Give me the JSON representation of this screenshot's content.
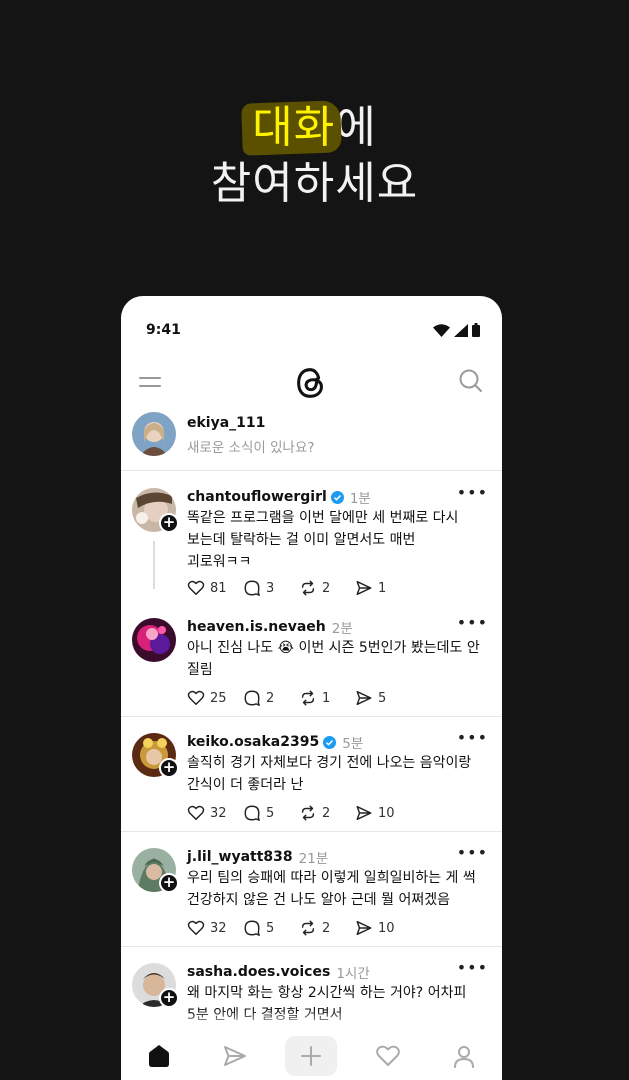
{
  "headline": {
    "highlight": "대화",
    "rest1": "에",
    "line2": "참여하세요"
  },
  "status": {
    "time": "9:41"
  },
  "compose": {
    "username": "ekiya_111",
    "placeholder": "새로운 소식이 있나요?"
  },
  "posts": [
    {
      "username": "chantouflowergirl",
      "verified": true,
      "ago": "1분",
      "lines": [
        "똑같은 프로그램을 이번 달에만 세 번째로 다시",
        "보는데 탈락하는 걸 이미 알면서도 매번",
        "괴로워ㅋㅋ"
      ],
      "likes": "81",
      "replies": "3",
      "reposts": "2",
      "shares": "1"
    },
    {
      "username": "heaven.is.nevaeh",
      "verified": false,
      "ago": "2분",
      "lines": [
        "아니 진심 나도 😭 이번 시즌 5번인가 봤는데도 안",
        "질림"
      ],
      "likes": "25",
      "replies": "2",
      "reposts": "1",
      "shares": "5"
    },
    {
      "username": "keiko.osaka2395",
      "verified": true,
      "ago": "5분",
      "lines": [
        "솔직히 경기 자체보다 경기 전에 나오는 음악이랑",
        "간식이 더 좋더라 난"
      ],
      "likes": "32",
      "replies": "5",
      "reposts": "2",
      "shares": "10"
    },
    {
      "username": "j.lil_wyatt838",
      "verified": false,
      "ago": "21분",
      "lines": [
        "우리 팀의 승패에 따라 이렇게 일희일비하는 게 썩",
        "건강하지 않은 건 나도 알아 근데 뭘 어쩌겠음"
      ],
      "likes": "32",
      "replies": "5",
      "reposts": "2",
      "shares": "10"
    },
    {
      "username": "sasha.does.voices",
      "verified": false,
      "ago": "1시간",
      "lines": [
        "왜 마지막 화는 항상 2시간씩 하는 거야? 어차피",
        "5분 안에 다 결정할 거면서"
      ],
      "likes": "",
      "replies": "",
      "reposts": "",
      "shares": ""
    }
  ],
  "icons": {
    "status": [
      "wifi-icon",
      "signal-icon",
      "battery-icon"
    ],
    "topbar": [
      "menu-icon",
      "threads-logo-icon",
      "search-icon"
    ],
    "actions": [
      "heart-icon",
      "comment-icon",
      "repost-icon",
      "send-icon"
    ],
    "nav": [
      "home-icon",
      "send-icon",
      "plus-icon",
      "heart-icon",
      "profile-icon"
    ]
  },
  "colors": {
    "background": "#141414",
    "highlight_text": "#fff200",
    "highlight_bg": "#5a5000",
    "verified": "#1d9bf0",
    "muted": "#999999"
  }
}
